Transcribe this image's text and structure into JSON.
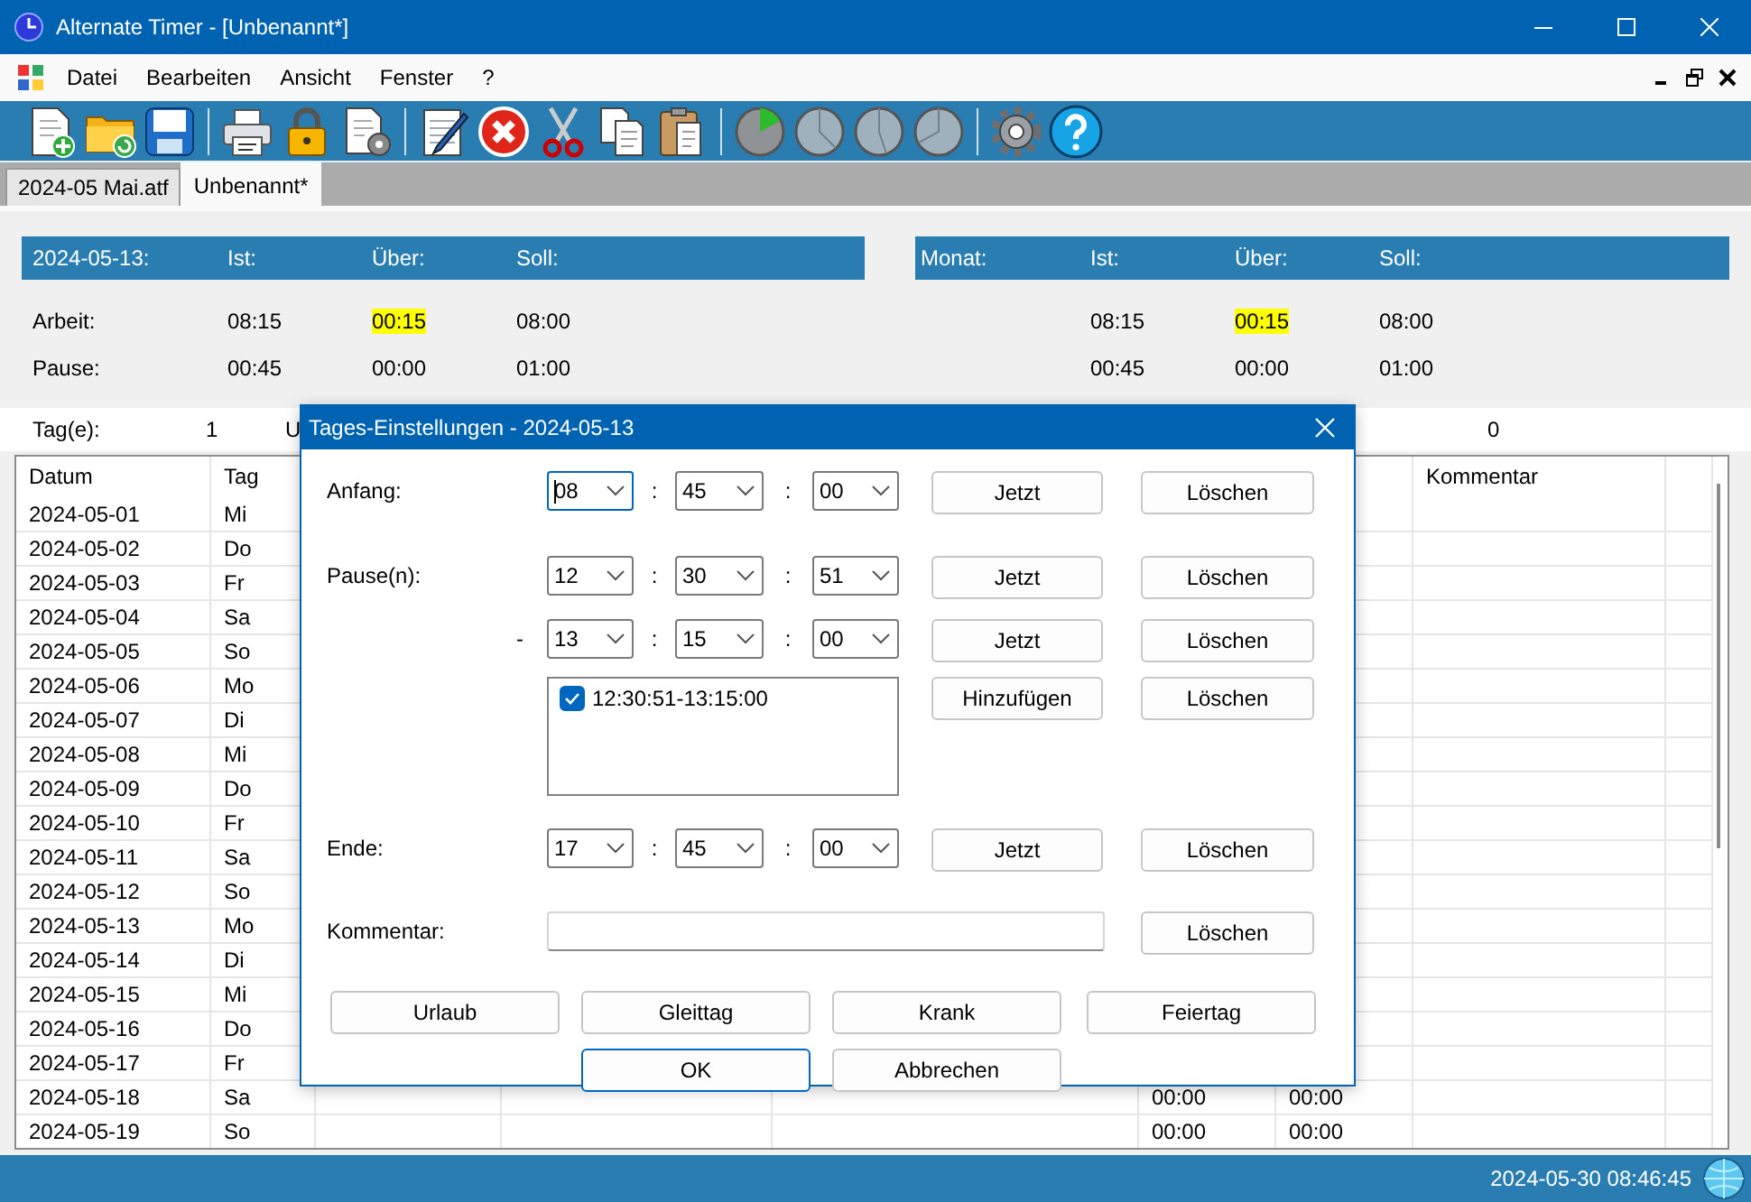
{
  "window": {
    "title": "Alternate Timer - [Unbenannt*]"
  },
  "menu": [
    "Datei",
    "Bearbeiten",
    "Ansicht",
    "Fenster",
    "?"
  ],
  "tabs": [
    {
      "label": "2024-05 Mai.atf",
      "selected": false
    },
    {
      "label": "Unbenannt*",
      "selected": true
    }
  ],
  "day_summary": {
    "heading": "2024-05-13:",
    "columns": [
      "Ist:",
      "Über:",
      "Soll:"
    ],
    "rows": [
      {
        "label": "Arbeit:",
        "values": [
          {
            "text": "08:15",
            "highlighted": false
          },
          {
            "text": "00:15",
            "highlighted": true
          },
          {
            "text": "08:00",
            "highlighted": false
          }
        ]
      },
      {
        "label": "Pause:",
        "values": [
          {
            "text": "00:45",
            "highlighted": false
          },
          {
            "text": "00:00",
            "highlighted": false
          },
          {
            "text": "01:00",
            "highlighted": false
          }
        ]
      }
    ]
  },
  "month_summary": {
    "heading": "Monat:",
    "columns": [
      "Ist:",
      "Über:",
      "Soll:"
    ],
    "rows": [
      {
        "values": [
          {
            "text": "08:15",
            "highlighted": false
          },
          {
            "text": "00:15",
            "highlighted": true
          },
          {
            "text": "08:00",
            "highlighted": false
          }
        ]
      },
      {
        "values": [
          {
            "text": "00:45",
            "highlighted": false
          },
          {
            "text": "00:00",
            "highlighted": false
          },
          {
            "text": "01:00",
            "highlighted": false
          }
        ]
      }
    ]
  },
  "days_row": {
    "label": "Tag(e):",
    "value_1": "1",
    "value_2": "U",
    "value_3": "0"
  },
  "table": {
    "columns": {
      "column_1": "Datum",
      "column_2": "Tag",
      "column_8": "Kommentar"
    },
    "rows": [
      {
        "column_1": "2024-05-01",
        "column_2": "Mi"
      },
      {
        "column_1": "2024-05-02",
        "column_2": "Do"
      },
      {
        "column_1": "2024-05-03",
        "column_2": "Fr"
      },
      {
        "column_1": "2024-05-04",
        "column_2": "Sa"
      },
      {
        "column_1": "2024-05-05",
        "column_2": "So"
      },
      {
        "column_1": "2024-05-06",
        "column_2": "Mo"
      },
      {
        "column_1": "2024-05-07",
        "column_2": "Di"
      },
      {
        "column_1": "2024-05-08",
        "column_2": "Mi"
      },
      {
        "column_1": "2024-05-09",
        "column_2": "Do"
      },
      {
        "column_1": "2024-05-10",
        "column_2": "Fr"
      },
      {
        "column_1": "2024-05-11",
        "column_2": "Sa"
      },
      {
        "column_1": "2024-05-12",
        "column_2": "So"
      },
      {
        "column_1": "2024-05-13",
        "column_2": "Mo"
      },
      {
        "column_1": "2024-05-14",
        "column_2": "Di"
      },
      {
        "column_1": "2024-05-15",
        "column_2": "Mi"
      },
      {
        "column_1": "2024-05-16",
        "column_2": "Do"
      },
      {
        "column_1": "2024-05-17",
        "column_2": "Fr"
      },
      {
        "column_1": "2024-05-18",
        "column_2": "Sa",
        "column_6": "00:00",
        "column_7": "00:00"
      },
      {
        "column_1": "2024-05-19",
        "column_2": "So",
        "column_6": "00:00",
        "column_7": "00:00"
      }
    ]
  },
  "dialog": {
    "title": "Tages-Einstellungen - 2024-05-13",
    "rows": [
      {
        "kind": "time",
        "label": "Anfang:",
        "fields": [
          {
            "value": "08",
            "focused": true
          },
          {
            "value": "45",
            "focused": false
          },
          {
            "value": "00",
            "focused": false
          }
        ],
        "separators": [
          ":",
          ":"
        ],
        "buttons": [
          "Jetzt",
          "Löschen"
        ]
      },
      {
        "kind": "time",
        "label": "Pause(n):",
        "fields": [
          {
            "value": "12",
            "focused": false
          },
          {
            "value": "30",
            "focused": false
          },
          {
            "value": "51",
            "focused": false
          }
        ],
        "separators": [
          ":",
          ":"
        ],
        "buttons": [
          "Jetzt",
          "Löschen"
        ]
      },
      {
        "kind": "time_end",
        "label": "-",
        "fields": [
          {
            "value": "13",
            "focused": false
          },
          {
            "value": "15",
            "focused": false
          },
          {
            "value": "00",
            "focused": false
          }
        ],
        "separators": [
          ":",
          ":"
        ],
        "buttons": [
          "Jetzt",
          "Löschen"
        ]
      },
      {
        "kind": "list",
        "items": [
          {
            "text": "12:30:51-13:15:00",
            "checked": true
          }
        ],
        "buttons": [
          "Hinzufügen",
          "Löschen"
        ]
      },
      {
        "kind": "time",
        "label": "Ende:",
        "fields": [
          {
            "value": "17",
            "focused": false
          },
          {
            "value": "45",
            "focused": false
          },
          {
            "value": "00",
            "focused": false
          }
        ],
        "separators": [
          ":",
          ":"
        ],
        "buttons": [
          "Jetzt",
          "Löschen"
        ]
      },
      {
        "kind": "comment",
        "label": "Kommentar:",
        "buttons": [
          "Löschen"
        ]
      }
    ],
    "day_buttons": [
      "Urlaub",
      "Gleittag",
      "Krank",
      "Feiertag"
    ],
    "actions": [
      {
        "label": "OK",
        "default": true
      },
      {
        "label": "Abbrechen",
        "default": false
      }
    ]
  },
  "status_bar": {
    "datetime": "2024-05-30 08:46:45"
  }
}
